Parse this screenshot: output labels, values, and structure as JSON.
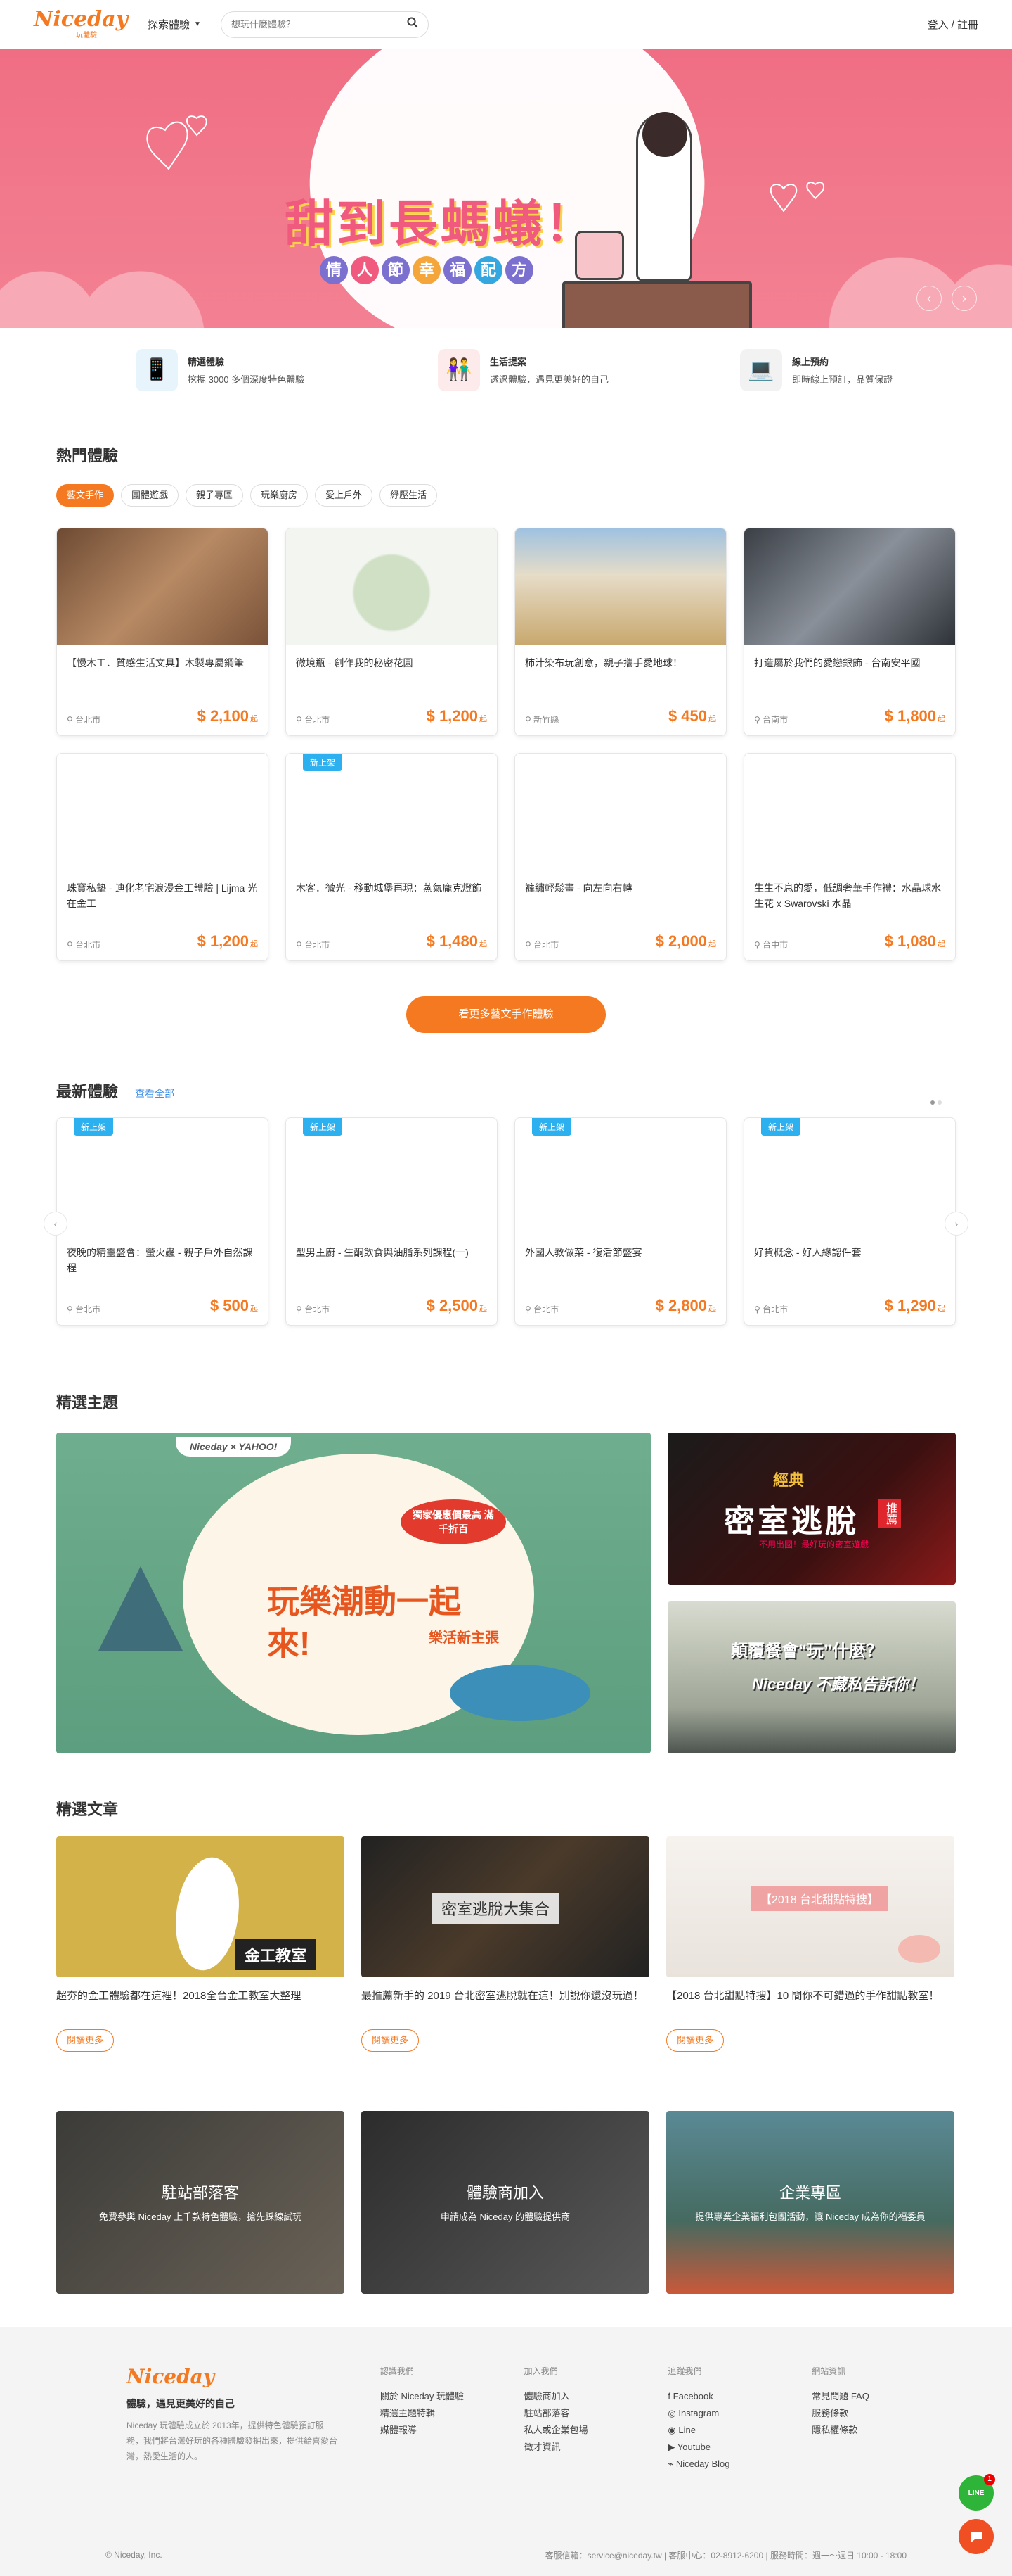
{
  "header": {
    "logo": "Niceday",
    "logo_sub": "玩體驗",
    "explore": "探索體驗",
    "search_placeholder": "想玩什麼體驗？",
    "login": "登入 / 註冊"
  },
  "hero": {
    "title": "甜到長螞蟻！",
    "subtitle": [
      "情",
      "人",
      "節",
      "幸",
      "福",
      "配",
      "方"
    ],
    "prev": "‹",
    "next": "›"
  },
  "features": [
    {
      "title": "精選體驗",
      "desc": "挖掘 3000 多個深度特色體驗",
      "icon": "phone-hand-icon"
    },
    {
      "title": "生活提案",
      "desc": "透過體驗，遇見更美好的自己",
      "icon": "couple-icon"
    },
    {
      "title": "線上預約",
      "desc": "即時線上預訂，品質保證",
      "icon": "laptop-check-icon"
    }
  ],
  "hot": {
    "title": "熱門體驗",
    "chips": [
      "藝文手作",
      "團體遊戲",
      "親子專區",
      "玩樂廚房",
      "愛上戶外",
      "紓壓生活"
    ],
    "active_chip": 0,
    "cards": [
      {
        "name": "【慢木工．質感生活文具】木製專屬鋼筆",
        "loc": "台北市",
        "price": "$ 2,100",
        "badge": ""
      },
      {
        "name": "微境瓶 - 創作我的秘密花園",
        "loc": "台北市",
        "price": "$ 1,200",
        "badge": ""
      },
      {
        "name": "柿汁染布玩創意，親子攜手愛地球！",
        "loc": "新竹縣",
        "price": "$ 450",
        "badge": ""
      },
      {
        "name": "打造屬於我們的愛戀銀飾 - 台南安平國",
        "loc": "台南市",
        "price": "$ 1,800",
        "badge": ""
      },
      {
        "name": "珠寶私塾 - 迪化老宅浪漫金工體驗 | Lijma 光在金工",
        "loc": "台北市",
        "price": "$ 1,200",
        "badge": ""
      },
      {
        "name": "木客．微光 - 移動城堡再現：蒸氣龐克燈飾",
        "loc": "台北市",
        "price": "$ 1,480",
        "badge": "新上架"
      },
      {
        "name": "褲繡輕鬆畫 - 向左向右轉",
        "loc": "台北市",
        "price": "$ 2,000",
        "badge": ""
      },
      {
        "name": "生生不息的愛，低調奢華手作禮：水晶球水生花 x Swarovski 水晶",
        "loc": "台中市",
        "price": "$ 1,080",
        "badge": ""
      }
    ],
    "price_suffix": "起",
    "more": "看更多藝文手作體驗"
  },
  "latest": {
    "title": "最新體驗",
    "view_all": "查看全部",
    "cards": [
      {
        "name": "夜晚的精靈盛會：螢火蟲 - 親子戶外自然課程",
        "loc": "台北市",
        "price": "$ 500",
        "badge": "新上架"
      },
      {
        "name": "型男主廚 - 生酮飲食與油脂系列課程(一)",
        "loc": "台北市",
        "price": "$ 2,500",
        "badge": "新上架"
      },
      {
        "name": "外國人教做菜 - 復活節盛宴",
        "loc": "台北市",
        "price": "$ 2,800",
        "badge": "新上架"
      },
      {
        "name": "好貨概念 - 好人緣認件套",
        "loc": "台北市",
        "price": "$ 1,290",
        "badge": "新上架"
      }
    ]
  },
  "themes": {
    "title": "精選主題",
    "big": {
      "brand": "Niceday × YAHOO!",
      "stamp": "獨家優惠價最高 滿千折百",
      "headline": "玩樂潮動一起來!",
      "sub": "樂活新主張"
    },
    "small1": {
      "headline": "密室逃脫",
      "tag": "經典",
      "badge": "推薦",
      "caption": "不用出國！最好玩的密室遊戲"
    },
    "small2": {
      "headline": "顛覆餐會“玩”什麼？",
      "sub": "Niceday 不藏私告訴你！"
    }
  },
  "articles": {
    "title": "精選文章",
    "read_more": "閱讀更多",
    "items": [
      {
        "title": "超夯的金工體驗都在這裡！2018全台金工教室大整理",
        "img_text": "金工教室"
      },
      {
        "title": "最推薦新手的 2019 台北密室逃脫就在這！別說你還沒玩過！",
        "img_text": "密室逃脫大集合"
      },
      {
        "title": "【2018 台北甜點特搜】10 間你不可錯過的手作甜點教室！",
        "img_text": "【2018 台北甜點特搜】"
      }
    ]
  },
  "promos": [
    {
      "title": "駐站部落客",
      "desc": "免費參與 Niceday 上千款特色體驗，搶先踩線試玩"
    },
    {
      "title": "體驗商加入",
      "desc": "申請成為 Niceday 的體驗提供商"
    },
    {
      "title": "企業專區",
      "desc": "提供專業企業福利包團活動，讓 Niceday 成為你的福委員"
    }
  ],
  "footer": {
    "logo": "Niceday",
    "tagline": "體驗，遇見更美好的自己",
    "about": "Niceday 玩體驗成立於 2013年，提供特色體驗預訂服務，我們將台灣好玩的各種體驗發掘出來，提供給喜愛台灣，熱愛生活的人。",
    "cols": [
      {
        "head": "認識我們",
        "links": [
          "關於 Niceday 玩體驗",
          "精選主題特輯",
          "媒體報導"
        ]
      },
      {
        "head": "加入我們",
        "links": [
          "體驗商加入",
          "駐站部落客",
          "私人或企業包場",
          "徵才資訊"
        ]
      },
      {
        "head": "追蹤我們",
        "links": [
          "Facebook",
          "Instagram",
          "Line",
          "Youtube",
          "Niceday Blog"
        ]
      },
      {
        "head": "網站資訊",
        "links": [
          "常見問題 FAQ",
          "服務條款",
          "隱私權條款"
        ]
      }
    ],
    "copyright": "© Niceday, Inc.",
    "contact": "客服信箱：service@niceday.tw | 客服中心：02-8912-6200 | 服務時間：週一～週日 10:00 - 18:00"
  },
  "fab": {
    "line": "LINE",
    "line_badge": "1"
  },
  "colors": {
    "accent": "#f47920",
    "badge": "#2db0f0",
    "hero": "#f06e83"
  }
}
